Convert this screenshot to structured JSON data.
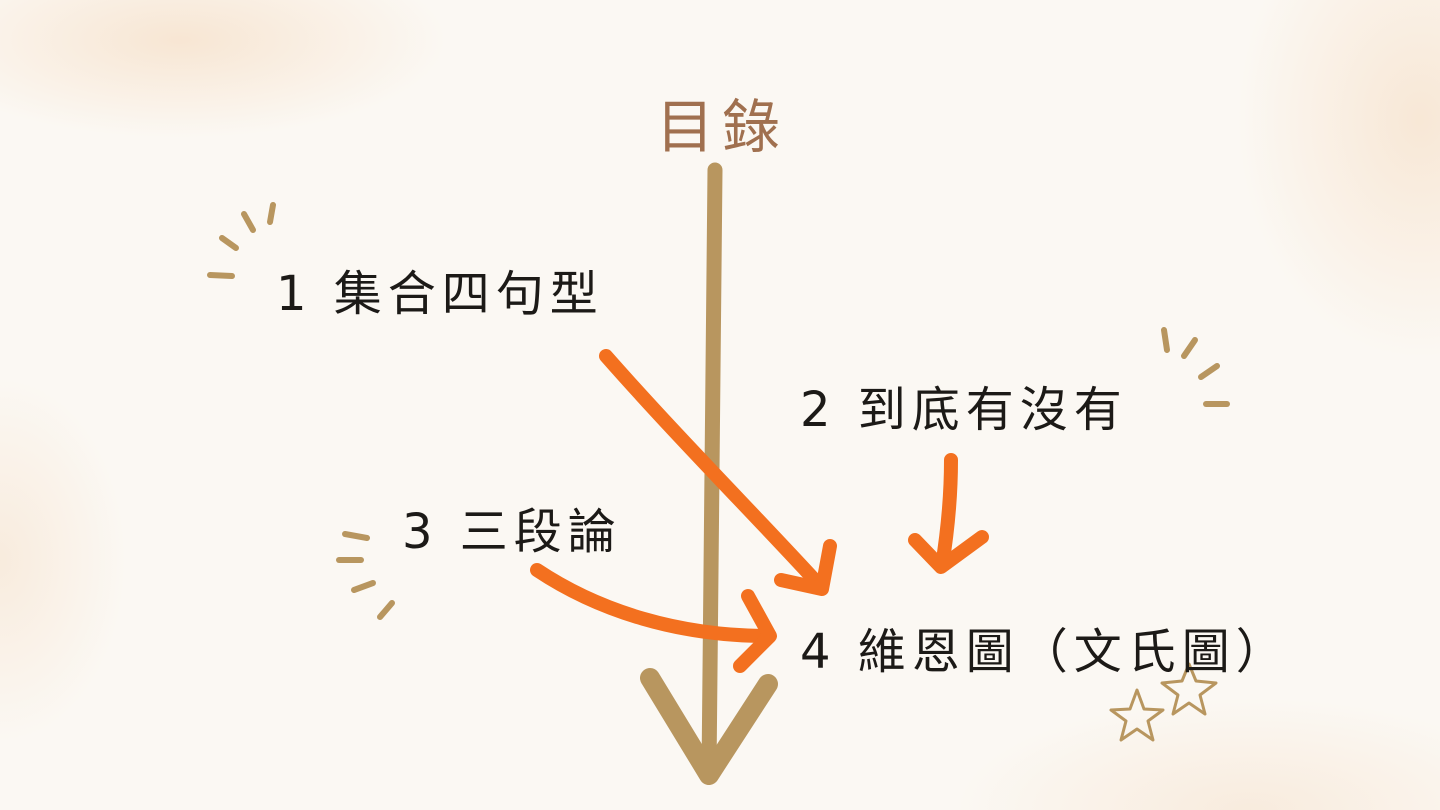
{
  "slide": {
    "title": "目錄",
    "items": [
      {
        "label": "1 集合四句型"
      },
      {
        "label": "2 到底有沒有"
      },
      {
        "label": "3 三段論"
      },
      {
        "label": "4 維恩圖（文氏圖）"
      }
    ]
  },
  "colors": {
    "background": "#fbf8f3",
    "title": "#a0704f",
    "text": "#1c1a17",
    "main_arrow": "#b8965f",
    "pointer_arrows": "#f3701f",
    "accent_strokes": "#b8965f"
  },
  "icons": {
    "main_arrow": "down-arrow-icon",
    "pointer_arrows": "curved-arrow-icon",
    "sparkles": "sparkle-lines-icon",
    "stars": "star-icon"
  }
}
